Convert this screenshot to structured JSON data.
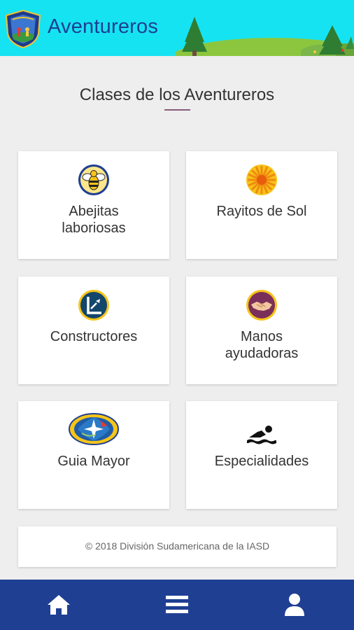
{
  "app": {
    "title": "Aventureros"
  },
  "page": {
    "title": "Clases de los Aventureros"
  },
  "classes": [
    {
      "line1": "Abejitas",
      "line2": "laboriosas",
      "icon": "bee-icon"
    },
    {
      "line1": "Rayitos de Sol",
      "line2": "",
      "icon": "sun-rays-icon"
    },
    {
      "line1": "Constructores",
      "line2": "",
      "icon": "builder-icon"
    },
    {
      "line1": "Manos",
      "line2": "ayudadoras",
      "icon": "handshake-icon"
    },
    {
      "line1": "Guia Mayor",
      "line2": "",
      "icon": "master-guide-emblem-icon"
    },
    {
      "line1": "Especialidades",
      "line2": "",
      "icon": "swimmer-icon"
    }
  ],
  "footer": {
    "text": "© 2018 División Sudamericana de la IASD"
  },
  "nav": {
    "items": [
      "home-icon",
      "menu-icon",
      "user-icon"
    ]
  },
  "colors": {
    "header": "#16e3f2",
    "title": "#1c3f93",
    "bottom_nav": "#1e3f92",
    "accent": "#8a5a7a"
  }
}
